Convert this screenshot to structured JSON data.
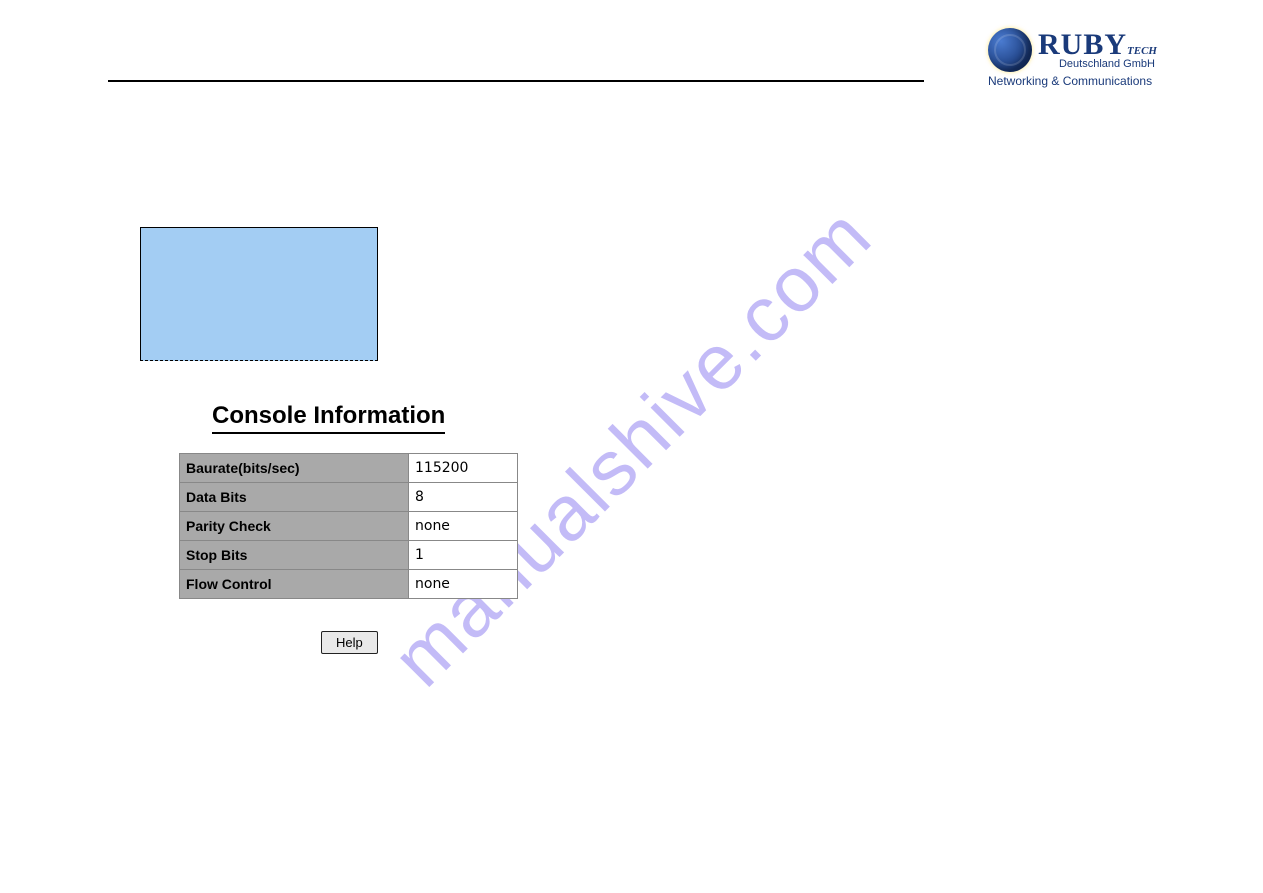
{
  "logo": {
    "brand": "RUBY",
    "brand_suffix": "TECH",
    "line1": "Deutschland GmbH",
    "line2": "Networking & Communications"
  },
  "watermark": "manualshive.com",
  "console": {
    "title": "Console Information",
    "rows": [
      {
        "label": "Baurate(bits/sec)",
        "value": "115200"
      },
      {
        "label": "Data Bits",
        "value": "8"
      },
      {
        "label": "Parity Check",
        "value": "none"
      },
      {
        "label": "Stop Bits",
        "value": "1"
      },
      {
        "label": "Flow Control",
        "value": "none"
      }
    ]
  },
  "buttons": {
    "help": "Help"
  }
}
